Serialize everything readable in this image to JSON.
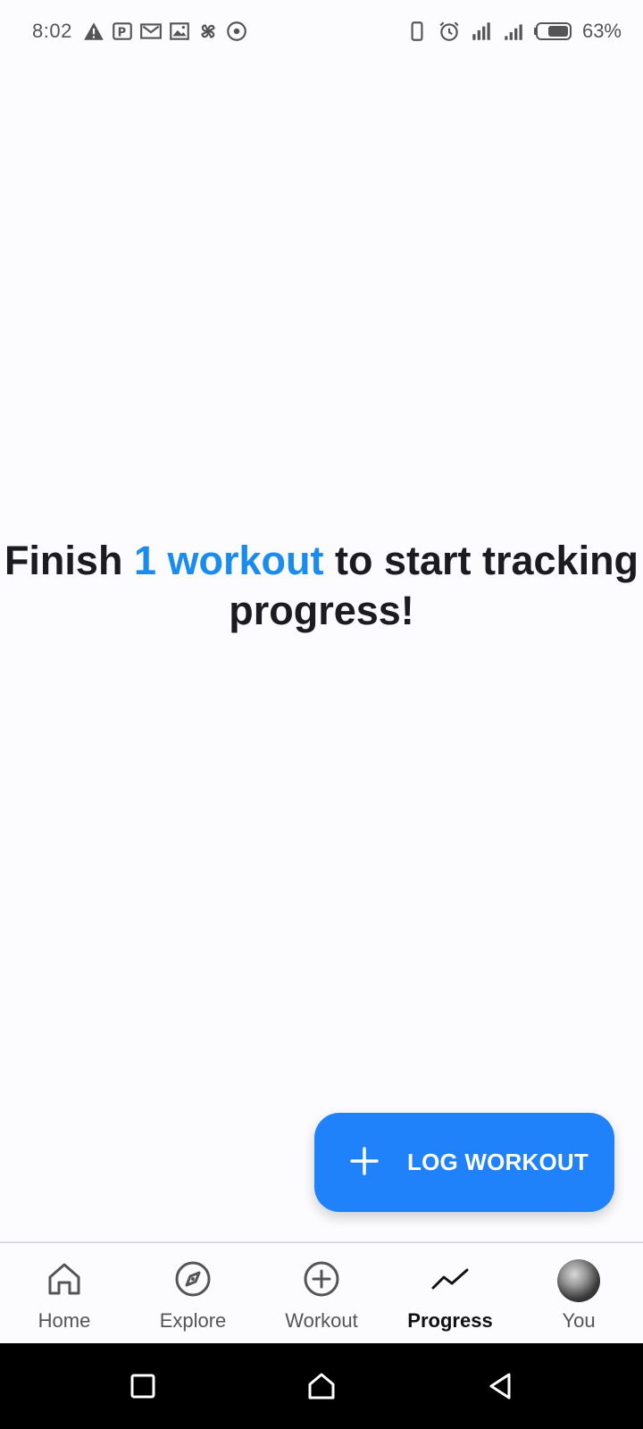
{
  "status_bar": {
    "time": "8:02",
    "battery_percent": "63%",
    "left_icons": [
      "warning-icon",
      "parking-app-icon",
      "gmail-icon",
      "gallery-icon",
      "pinwheel-icon",
      "record-icon"
    ],
    "right_icons": [
      "vibrate-icon",
      "alarm-icon",
      "signal-icon",
      "signal-icon",
      "battery-icon"
    ]
  },
  "empty_state": {
    "prefix": "Finish ",
    "highlight": "1 workout",
    "suffix": " to start tracking progress!"
  },
  "fab": {
    "label": "LOG WORKOUT",
    "icon": "plus-icon"
  },
  "bottom_nav": {
    "items": [
      {
        "label": "Home",
        "icon": "home-icon"
      },
      {
        "label": "Explore",
        "icon": "compass-icon"
      },
      {
        "label": "Workout",
        "icon": "add-circle-icon"
      },
      {
        "label": "Progress",
        "icon": "trend-icon"
      },
      {
        "label": "You",
        "icon": "avatar"
      }
    ],
    "active": "Progress"
  },
  "colors": {
    "accent": "#1f82fa",
    "highlight_text": "#1a8cf0",
    "text_dark": "#1c1c20",
    "background": "#fcfcfe"
  }
}
